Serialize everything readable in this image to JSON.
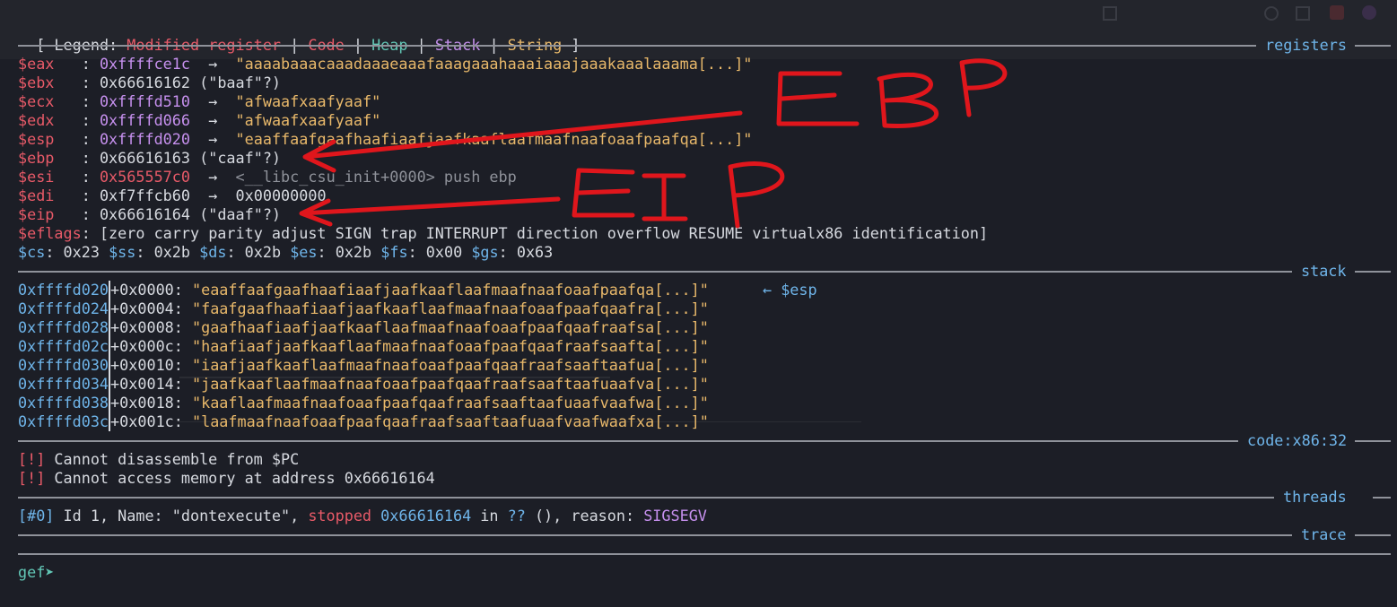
{
  "legend": {
    "open": "[ Legend: ",
    "modified": "Modified register",
    "sep1": " | ",
    "code": "Code",
    "sep2": " | ",
    "heap": "Heap",
    "sep3": " | ",
    "stack": "Stack",
    "sep4": " | ",
    "string": "String",
    "close": " ]"
  },
  "sections": {
    "registers": "registers",
    "stack": "stack",
    "code": "code:x86:32",
    "threads": "threads",
    "trace": "trace"
  },
  "registers": [
    {
      "name": "$eax",
      "sep": "   : ",
      "value": "0xffffce1c",
      "arrow": "  →  ",
      "deref": "\"aaaabaaacaaadaaaeaaafaaagaaahaaaiaaajaaakaaalaaama[...]\""
    },
    {
      "name": "$ebx",
      "sep": "   : ",
      "value": "0x66616162",
      "arrow": " ",
      "deref": "(\"baaf\"?)"
    },
    {
      "name": "$ecx",
      "sep": "   : ",
      "value": "0xffffd510",
      "arrow": "  →  ",
      "deref": "\"afwaafxaafyaaf\""
    },
    {
      "name": "$edx",
      "sep": "   : ",
      "value": "0xffffd066",
      "arrow": "  →  ",
      "deref": "\"afwaafxaafyaaf\""
    },
    {
      "name": "$esp",
      "sep": "   : ",
      "value": "0xffffd020",
      "arrow": "  →  ",
      "deref": "\"eaaffaafgaafhaafiaafjaafkaaflaafmaafnaafoaafpaafqa[...]\""
    },
    {
      "name": "$ebp",
      "sep": "   : ",
      "value": "0x66616163",
      "arrow": " ",
      "deref": "(\"caaf\"?)"
    },
    {
      "name": "$esi",
      "sep": "   : ",
      "value": "0x565557c0",
      "arrow": "  →  ",
      "deref": "<__libc_csu_init+0000> push ebp"
    },
    {
      "name": "$edi",
      "sep": "   : ",
      "value": "0xf7ffcb60",
      "arrow": "  →  ",
      "deref": "0x00000000"
    },
    {
      "name": "$eip",
      "sep": "   : ",
      "value": "0x66616164",
      "arrow": " ",
      "deref": "(\"daaf\"?)"
    }
  ],
  "eflags": {
    "name": "$eflags",
    "sep": ": ",
    "value": "[zero carry parity adjust SIGN trap INTERRUPT direction overflow RESUME virtualx86 identification]"
  },
  "segments": [
    {
      "name": "$cs",
      "value": "0x23"
    },
    {
      "name": "$ss",
      "value": "0x2b"
    },
    {
      "name": "$ds",
      "value": "0x2b"
    },
    {
      "name": "$es",
      "value": "0x2b"
    },
    {
      "name": "$fs",
      "value": "0x00"
    },
    {
      "name": "$gs",
      "value": "0x63"
    }
  ],
  "stack": [
    {
      "addr": "0xffffd020",
      "off": "+0x0000: ",
      "val": "\"eaaffaafgaafhaafiaafjaafkaaflaafmaafnaafoaafpaafqa[...]\""
    },
    {
      "addr": "0xffffd024",
      "off": "+0x0004: ",
      "val": "\"faafgaafhaafiaafjaafkaaflaafmaafnaafoaafpaafqaafra[...]\""
    },
    {
      "addr": "0xffffd028",
      "off": "+0x0008: ",
      "val": "\"gaafhaafiaafjaafkaaflaafmaafnaafoaafpaafqaafraafsa[...]\""
    },
    {
      "addr": "0xffffd02c",
      "off": "+0x000c: ",
      "val": "\"haafiaafjaafkaaflaafmaafnaafoaafpaafqaafraafsaafta[...]\""
    },
    {
      "addr": "0xffffd030",
      "off": "+0x0010: ",
      "val": "\"iaafjaafkaaflaafmaafnaafoaafpaafqaafraafsaaftaafua[...]\""
    },
    {
      "addr": "0xffffd034",
      "off": "+0x0014: ",
      "val": "\"jaafkaaflaafmaafnaafoaafpaafqaafraafsaaftaafuaafva[...]\""
    },
    {
      "addr": "0xffffd038",
      "off": "+0x0018: ",
      "val": "\"kaaflaafmaafnaafoaafpaafqaafraafsaaftaafuaafvaafwa[...]\""
    },
    {
      "addr": "0xffffd03c",
      "off": "+0x001c: ",
      "val": "\"laafmaafnaafoaafpaafqaafraafsaaftaafuaafvaafwaafxa[...]\""
    }
  ],
  "stack_esp_marker": "← $esp",
  "code": {
    "tag": "[!]",
    "msg1": " Cannot disassemble from $PC",
    "msg2": " Cannot access memory at address 0x66616164"
  },
  "thread": {
    "id": "[#0]",
    "text1": " Id 1, Name: \"dontexecute\", ",
    "state": "stopped",
    "sp": " ",
    "addr": "0x66616164",
    "text2": " in ",
    "func": "??",
    "text3": " (), reason: ",
    "reason": "SIGSEGV"
  },
  "prompt": "gef➤ ",
  "annotations": {
    "ebp": "EBP",
    "eip": "EIP",
    "color": "#e0161c"
  }
}
